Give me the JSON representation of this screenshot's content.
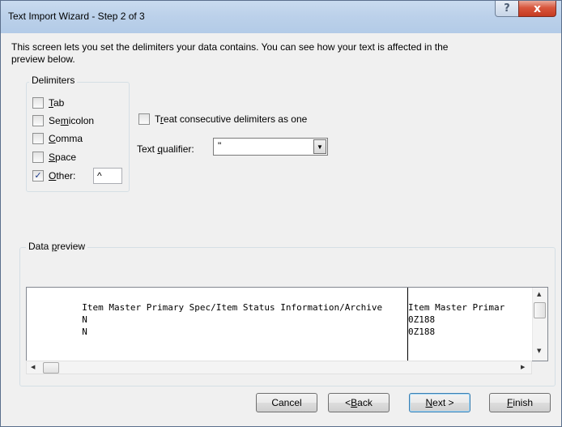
{
  "window": {
    "title": "Text Import Wizard - Step 2 of 3",
    "help_glyph": "?",
    "close_glyph": "x"
  },
  "intro": {
    "line1": "This screen lets you set the delimiters your data contains.  You can see how your text is affected in the",
    "line2": "preview below."
  },
  "delimiters": {
    "group_label": "Delimiters",
    "items": [
      {
        "pre": "",
        "key": "T",
        "post": "ab",
        "checked": false
      },
      {
        "pre": "Se",
        "key": "m",
        "post": "icolon",
        "checked": false
      },
      {
        "pre": "",
        "key": "C",
        "post": "omma",
        "checked": false
      },
      {
        "pre": "",
        "key": "S",
        "post": "pace",
        "checked": false
      },
      {
        "pre": "",
        "key": "O",
        "post": "ther:",
        "checked": true
      }
    ],
    "other_value": "^"
  },
  "consecutive": {
    "pre": "T",
    "key": "r",
    "post": "eat consecutive delimiters as one",
    "checked": false
  },
  "qualifier": {
    "pre": "Text ",
    "key": "q",
    "post": "ualifier:",
    "value": "\""
  },
  "preview": {
    "group_label_pre": "Data ",
    "group_label_key": "p",
    "group_label_post": "review",
    "rows": [
      {
        "c1": "Item Master Primary Spec/Item Status Information/Archive",
        "c2": "Item Master Primar"
      },
      {
        "c1": "N",
        "c2": "0Z188"
      },
      {
        "c1": "N",
        "c2": "0Z188"
      }
    ]
  },
  "buttons": {
    "cancel": "Cancel",
    "back_pre": "< ",
    "back_key": "B",
    "back_post": "ack",
    "next_key": "N",
    "next_post": "ext >",
    "finish_key": "F",
    "finish_post": "inish"
  },
  "scroll_arrows": {
    "up": "▲",
    "down": "▼",
    "left": "◀",
    "right": "▶",
    "combo": "▼"
  }
}
